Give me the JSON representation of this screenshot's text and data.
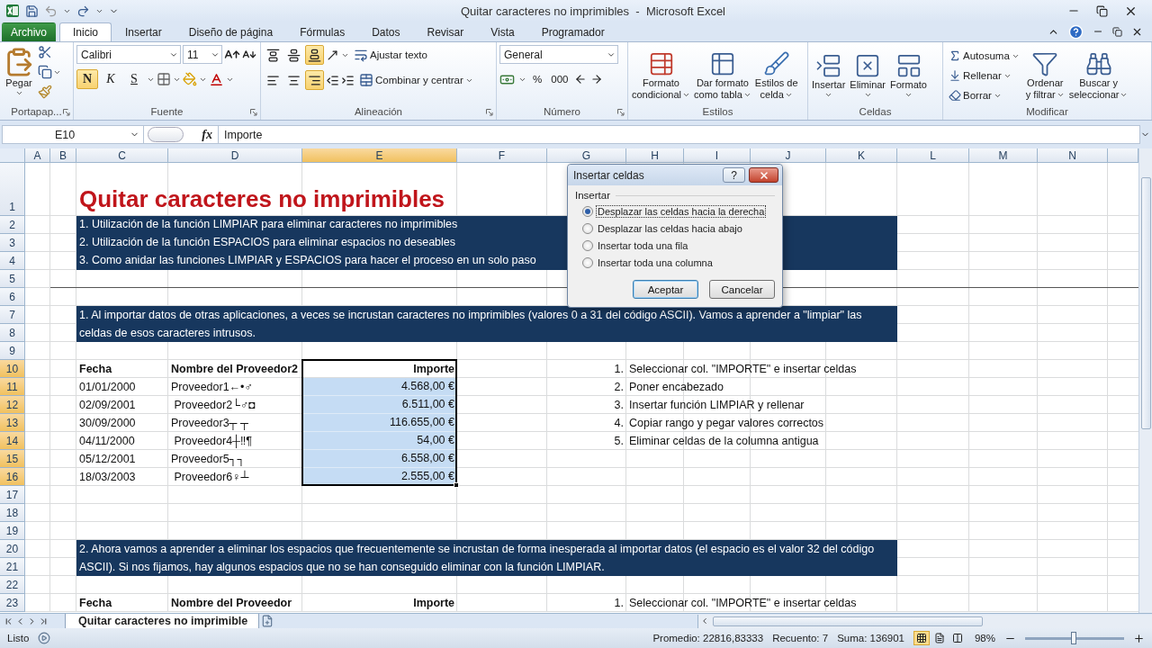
{
  "window": {
    "title": "Quitar caracteres no imprimibles  -  Microsoft Excel"
  },
  "tabs": [
    {
      "label": "Archivo",
      "kind": "file",
      "selected": false
    },
    {
      "label": "Inicio",
      "kind": "tab",
      "selected": true
    },
    {
      "label": "Insertar",
      "kind": "tab",
      "selected": false
    },
    {
      "label": "Diseño de página",
      "kind": "tab",
      "selected": false
    },
    {
      "label": "Fórmulas",
      "kind": "tab",
      "selected": false
    },
    {
      "label": "Datos",
      "kind": "tab",
      "selected": false
    },
    {
      "label": "Revisar",
      "kind": "tab",
      "selected": false
    },
    {
      "label": "Vista",
      "kind": "tab",
      "selected": false
    },
    {
      "label": "Programador",
      "kind": "tab",
      "selected": false
    }
  ],
  "ribbon": {
    "groups": [
      {
        "kind": "clipboard",
        "label": "Portapap...",
        "paste": "Pegar"
      },
      {
        "kind": "font",
        "label": "Fuente",
        "font": "Calibri",
        "size": "11",
        "styles": [
          {
            "kind": "bold",
            "label": "N",
            "selected": true
          },
          {
            "kind": "italic",
            "label": "K",
            "selected": false
          },
          {
            "kind": "underline",
            "label": "S",
            "selected": false
          }
        ]
      },
      {
        "kind": "alignment",
        "label": "Alineación",
        "vertical": [
          {
            "selected": false
          },
          {
            "selected": false
          },
          {
            "selected": true
          }
        ],
        "horizontal": [
          {
            "selected": false
          },
          {
            "selected": false
          },
          {
            "selected": true
          }
        ],
        "wrap": "Ajustar texto",
        "merge": "Combinar y centrar"
      },
      {
        "kind": "number",
        "label": "Número",
        "format": "General",
        "percent": "%",
        "thousands": "000"
      },
      {
        "kind": "styles",
        "label": "Estilos",
        "buttons": [
          {
            "lines": [
              "Formato",
              "condicional"
            ]
          },
          {
            "lines": [
              "Dar formato",
              "como tabla"
            ]
          },
          {
            "lines": [
              "Estilos de",
              "celda"
            ]
          }
        ]
      },
      {
        "kind": "cells",
        "label": "Celdas",
        "buttons": [
          "Insertar",
          "Eliminar",
          "Formato"
        ]
      },
      {
        "kind": "editing",
        "label": "Modificar",
        "small": [
          "Autosuma",
          "Rellenar",
          "Borrar"
        ],
        "big": [
          {
            "lines": [
              "Ordenar",
              "y filtrar"
            ]
          },
          {
            "lines": [
              "Buscar y",
              "seleccionar"
            ]
          }
        ]
      }
    ]
  },
  "formula_bar": {
    "name_box": "E10",
    "fx": "fx",
    "formula": "Importe"
  },
  "columns": [
    {
      "label": "A",
      "selected": false
    },
    {
      "label": "B",
      "selected": false
    },
    {
      "label": "C",
      "selected": false
    },
    {
      "label": "D",
      "selected": false
    },
    {
      "label": "E",
      "selected": true
    },
    {
      "label": "F",
      "selected": false
    },
    {
      "label": "G",
      "selected": false
    },
    {
      "label": "H",
      "selected": false
    },
    {
      "label": "I",
      "selected": false
    },
    {
      "label": "J",
      "selected": false
    },
    {
      "label": "K",
      "selected": false
    },
    {
      "label": "L",
      "selected": false
    },
    {
      "label": "M",
      "selected": false
    },
    {
      "label": "N",
      "selected": false
    }
  ],
  "rows": [
    {
      "n": "1",
      "selected": false,
      "cells": {
        "C": {
          "kind": "title",
          "text": "Quitar caracteres no imprimibles",
          "selected": false
        }
      }
    },
    {
      "n": "2",
      "selected": false,
      "cells": {
        "C": {
          "kind": "band",
          "text": "1. Utilización de la función LIMPIAR para eliminar caracteres no imprimibles",
          "selected": false
        }
      }
    },
    {
      "n": "3",
      "selected": false,
      "cells": {
        "C": {
          "kind": "band",
          "text": "2. Utilización de la función ESPACIOS para eliminar espacios no deseables",
          "selected": false
        }
      }
    },
    {
      "n": "4",
      "selected": false,
      "cells": {
        "C": {
          "kind": "band",
          "text": "3. Como anidar las funciones LIMPIAR y ESPACIOS para hacer el proceso en un solo paso",
          "selected": false
        }
      }
    },
    {
      "n": "5",
      "selected": false
    },
    {
      "n": "6",
      "selected": false
    },
    {
      "n": "7",
      "selected": false,
      "cells": {
        "C": {
          "kind": "band_tall",
          "text": "1. Al importar datos de otras aplicaciones, a veces se incrustan caracteres no imprimibles (valores 0 a 31 del código ASCII). Vamos a aprender a \"limpiar\" las celdas de esos caracteres intrusos.",
          "selected": false
        }
      }
    },
    {
      "n": "8",
      "selected": false
    },
    {
      "n": "9",
      "selected": false
    },
    {
      "n": "10",
      "selected": true,
      "cells": {
        "C": {
          "kind": "header",
          "text": "Fecha",
          "selected": false
        },
        "D": {
          "kind": "header",
          "text": "Nombre del Proveedor2",
          "selected": false
        },
        "E": {
          "kind": "amount_header",
          "text": "Importe",
          "selected": true
        },
        "G": {
          "kind": "step_num",
          "text": "1.",
          "selected": false
        },
        "H": {
          "kind": "step_text",
          "text": "Seleccionar col. \"IMPORTE\" e insertar celdas",
          "selected": false
        }
      }
    },
    {
      "n": "11",
      "selected": true,
      "cells": {
        "C": {
          "kind": "date",
          "text": "01/01/2000",
          "selected": false
        },
        "D": {
          "kind": "name",
          "text": "Proveedor1←•♂",
          "selected": false
        },
        "E": {
          "kind": "amount",
          "text": "4.568,00 €",
          "selected": true
        },
        "G": {
          "kind": "step_num",
          "text": "2.",
          "selected": false
        },
        "H": {
          "kind": "step_text",
          "text": "Poner encabezado",
          "selected": false
        }
      }
    },
    {
      "n": "12",
      "selected": true,
      "cells": {
        "C": {
          "kind": "date",
          "text": "02/09/2001",
          "selected": false
        },
        "D": {
          "kind": "name",
          "text": " Proveedor2└♂◘",
          "selected": false
        },
        "E": {
          "kind": "amount",
          "text": "6.511,00 €",
          "selected": true
        },
        "G": {
          "kind": "step_num",
          "text": "3.",
          "selected": false
        },
        "H": {
          "kind": "step_text",
          "text": "Insertar función LIMPIAR y rellenar",
          "selected": false
        }
      }
    },
    {
      "n": "13",
      "selected": true,
      "cells": {
        "C": {
          "kind": "date",
          "text": "30/09/2000",
          "selected": false
        },
        "D": {
          "kind": "name",
          "text": "Proveedor3┬ ┬",
          "selected": false
        },
        "E": {
          "kind": "amount",
          "text": "116.655,00 €",
          "selected": true
        },
        "G": {
          "kind": "step_num",
          "text": "4.",
          "selected": false
        },
        "H": {
          "kind": "step_text",
          "text": "Copiar rango y pegar valores correctos",
          "selected": false
        }
      }
    },
    {
      "n": "14",
      "selected": true,
      "cells": {
        "C": {
          "kind": "date",
          "text": "04/11/2000",
          "selected": false
        },
        "D": {
          "kind": "name",
          "text": " Proveedor4┼‼¶",
          "selected": false
        },
        "E": {
          "kind": "amount",
          "text": "54,00 €",
          "selected": true
        },
        "G": {
          "kind": "step_num",
          "text": "5.",
          "selected": false
        },
        "H": {
          "kind": "step_text",
          "text": "Eliminar celdas de la columna antigua",
          "selected": false
        }
      }
    },
    {
      "n": "15",
      "selected": true,
      "cells": {
        "C": {
          "kind": "date",
          "text": "05/12/2001",
          "selected": false
        },
        "D": {
          "kind": "name",
          "text": "Proveedor5┐┐",
          "selected": false
        },
        "E": {
          "kind": "amount",
          "text": "6.558,00 €",
          "selected": true
        }
      }
    },
    {
      "n": "16",
      "selected": true,
      "cells": {
        "C": {
          "kind": "date",
          "text": "18/03/2003",
          "selected": false
        },
        "D": {
          "kind": "name",
          "text": " Proveedor6♀┴",
          "selected": false
        },
        "E": {
          "kind": "amount",
          "text": "2.555,00 €",
          "selected": true
        }
      }
    },
    {
      "n": "17",
      "selected": false
    },
    {
      "n": "18",
      "selected": false
    },
    {
      "n": "19",
      "selected": false
    },
    {
      "n": "20",
      "selected": false,
      "cells": {
        "C": {
          "kind": "band_tall",
          "text": "2. Ahora vamos a aprender a eliminar los espacios que frecuentemente se incrustan de forma inesperada al importar datos (el espacio es el valor 32 del código ASCII). Si nos fijamos, hay algunos espacios que no se han conseguido eliminar con la función LIMPIAR.",
          "selected": false
        }
      }
    },
    {
      "n": "21",
      "selected": false
    },
    {
      "n": "22",
      "selected": false
    },
    {
      "n": "23",
      "selected": false,
      "cells": {
        "C": {
          "kind": "header",
          "text": "Fecha",
          "selected": false
        },
        "D": {
          "kind": "header",
          "text": "Nombre del Proveedor",
          "selected": false
        },
        "E": {
          "kind": "amount_header",
          "text": "Importe",
          "selected": false
        },
        "G": {
          "kind": "step_num",
          "text": "1.",
          "selected": false
        },
        "H": {
          "kind": "step_text",
          "text": "Seleccionar col. \"IMPORTE\" e insertar celdas",
          "selected": false
        }
      }
    }
  ],
  "dialog": {
    "title": "Insertar celdas",
    "help": "?",
    "group": "Insertar",
    "options": [
      {
        "label": "Desplazar las celdas hacia la derecha",
        "selected": true
      },
      {
        "label": "Desplazar las celdas hacia abajo",
        "selected": false
      },
      {
        "label": "Insertar toda una fila",
        "selected": false
      },
      {
        "label": "Insertar toda una columna",
        "selected": false
      }
    ],
    "buttons": [
      {
        "label": "Aceptar",
        "kind": "default"
      },
      {
        "label": "Cancelar",
        "kind": "normal"
      }
    ]
  },
  "sheet_tabs": [
    {
      "label": "Quitar caracteres no imprimible",
      "selected": true
    }
  ],
  "status_bar": {
    "mode": "Listo",
    "stats": [
      "Promedio: 22816,83333",
      "Recuento: 7",
      "Suma: 136901"
    ],
    "views": [
      {
        "selected": true
      },
      {
        "selected": false
      },
      {
        "selected": false
      }
    ],
    "zoom": "98%",
    "zoom_slider": {
      "level": 0.49
    }
  }
}
